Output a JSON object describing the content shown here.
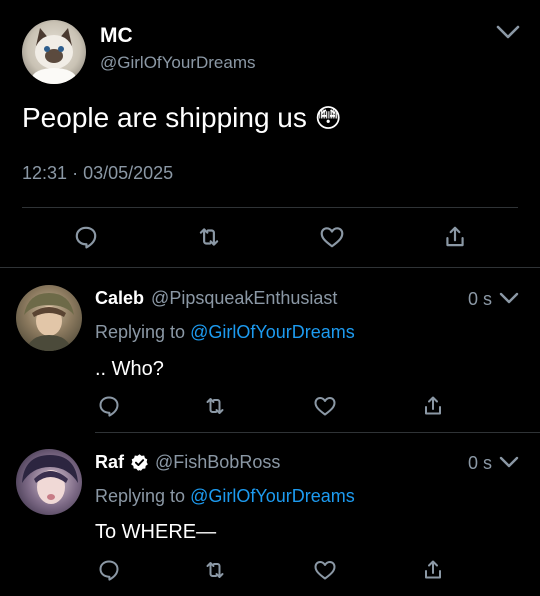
{
  "main_tweet": {
    "display_name": "MC",
    "handle": "@GirlOfYourDreams",
    "text": "People are shipping us",
    "emoji": "😳",
    "time": "12:31",
    "separator": "·",
    "date": "03/05/2025"
  },
  "replies": [
    {
      "display_name": "Caleb",
      "handle": "@PipsqueakEnthusiast",
      "time": "0 s",
      "replying_prefix": "Replying to",
      "replying_handle": "@GirlOfYourDreams",
      "text": ".. Who?",
      "verified": false
    },
    {
      "display_name": "Raf",
      "handle": "@FishBobRoss",
      "time": "0 s",
      "replying_prefix": "Replying to",
      "replying_handle": "@GirlOfYourDreams",
      "text": "To WHERE—",
      "verified": true
    }
  ],
  "colors": {
    "background": "#000000",
    "secondary_text": "#8b98a5",
    "link": "#1d9bf0",
    "divider": "#2f3336"
  },
  "icons": [
    "chevron-down-icon",
    "reply-icon",
    "retweet-icon",
    "like-icon",
    "share-icon",
    "verified-badge-icon"
  ]
}
